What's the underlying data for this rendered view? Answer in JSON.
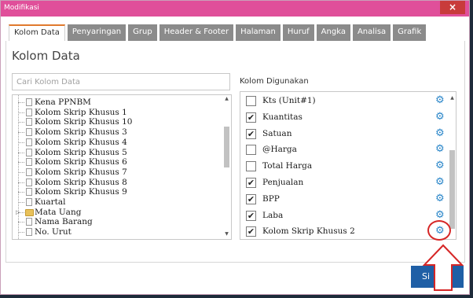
{
  "window": {
    "title": "Modifikasi",
    "close_symbol": "×"
  },
  "tabs": [
    {
      "label": "Kolom Data",
      "active": true
    },
    {
      "label": "Penyaringan",
      "active": false
    },
    {
      "label": "Grup",
      "active": false
    },
    {
      "label": "Header & Footer",
      "active": false
    },
    {
      "label": "Halaman",
      "active": false
    },
    {
      "label": "Huruf",
      "active": false
    },
    {
      "label": "Angka",
      "active": false
    },
    {
      "label": "Analisa",
      "active": false
    },
    {
      "label": "Grafik",
      "active": false
    }
  ],
  "main": {
    "heading": "Kolom Data",
    "search_placeholder": "Cari Kolom Data",
    "used_label": "Kolom Digunakan"
  },
  "tree_items": [
    {
      "label": "Kena PPNBM",
      "type": "file"
    },
    {
      "label": "Kolom Skrip Khusus 1",
      "type": "file"
    },
    {
      "label": "Kolom Skrip Khusus 10",
      "type": "file"
    },
    {
      "label": "Kolom Skrip Khusus 3",
      "type": "file"
    },
    {
      "label": "Kolom Skrip Khusus 4",
      "type": "file"
    },
    {
      "label": "Kolom Skrip Khusus 5",
      "type": "file"
    },
    {
      "label": "Kolom Skrip Khusus 6",
      "type": "file"
    },
    {
      "label": "Kolom Skrip Khusus 7",
      "type": "file"
    },
    {
      "label": "Kolom Skrip Khusus 8",
      "type": "file"
    },
    {
      "label": "Kolom Skrip Khusus 9",
      "type": "file"
    },
    {
      "label": "Kuartal",
      "type": "file"
    },
    {
      "label": "Mata Uang",
      "type": "folder"
    },
    {
      "label": "Nama Barang",
      "type": "file"
    },
    {
      "label": "No. Urut",
      "type": "file"
    }
  ],
  "used_columns": [
    {
      "label": "Kts (Unit#1)",
      "checked": false
    },
    {
      "label": "Kuantitas",
      "checked": true
    },
    {
      "label": "Satuan",
      "checked": true
    },
    {
      "label": "@Harga",
      "checked": false
    },
    {
      "label": "Total Harga",
      "checked": false
    },
    {
      "label": "Penjualan",
      "checked": true
    },
    {
      "label": "BPP",
      "checked": true
    },
    {
      "label": "Laba",
      "checked": true
    },
    {
      "label": "Kolom Skrip Khusus 2",
      "checked": true
    }
  ],
  "footer": {
    "save_label": "Si"
  },
  "icons": {
    "settings": "gear-icon",
    "file": "file-icon",
    "folder": "folder-icon"
  },
  "colors": {
    "titlebar": "#e04f9a",
    "close": "#c83b3b",
    "tab_inactive": "#8b8b8b",
    "tab_active_accent": "#e07a2e",
    "gear": "#2a86c9",
    "save_button": "#1f5fa6",
    "highlight": "#d62626"
  }
}
